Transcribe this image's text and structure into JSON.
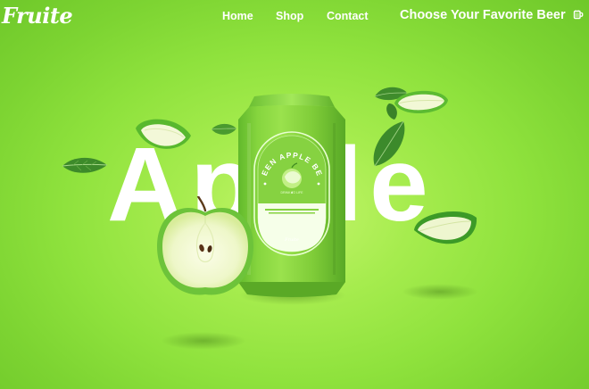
{
  "brand": {
    "logo_text": "Fruite"
  },
  "nav": {
    "links": [
      {
        "label": "Home"
      },
      {
        "label": "Shop"
      },
      {
        "label": "Contact"
      }
    ],
    "cta_label": "Choose Your Favorite Beer",
    "cta_icon": "beer-mug-icon"
  },
  "hero": {
    "big_word": "Apple",
    "can": {
      "arc_title": "GREEN APPLE BEER",
      "tagline": "DRINK TO LIFE",
      "brand_mark": "Fruite"
    }
  },
  "colors": {
    "background": "#8fe23d",
    "can_green": "#7fd33a",
    "text": "#ffffff"
  }
}
